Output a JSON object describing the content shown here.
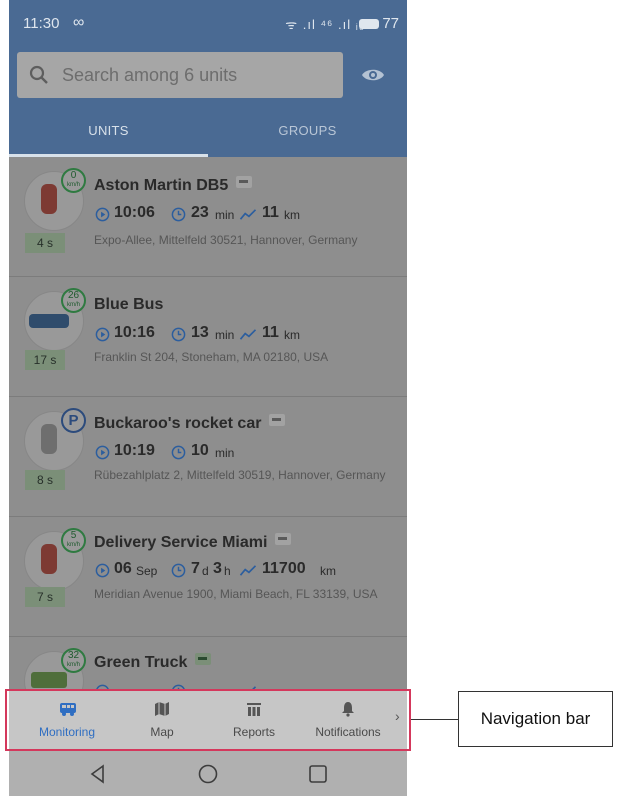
{
  "status_bar": {
    "time": "11:30",
    "loop_symbol": "∞",
    "signal_text": "ᯤ .ıl ⁴⁶ .ıl ᵢ₆",
    "battery": "77"
  },
  "search": {
    "placeholder": "Search among 6 units",
    "icon": "search-icon",
    "visibility_icon": "eye-icon"
  },
  "tabs": [
    {
      "label": "UNITS",
      "selected": true
    },
    {
      "label": "GROUPS",
      "selected": false
    }
  ],
  "units": [
    {
      "name": "Aston Martin DB5",
      "has_key": true,
      "key_color": "grey",
      "icon_type": "car-red",
      "badge": "speed",
      "speed": "0",
      "speed_unit": "km/h",
      "time": "10:06",
      "duration_value": "23",
      "duration_unit": "min",
      "distance_value": "11",
      "distance_unit": "km",
      "address": "Expo-Allee, Mittelfeld 30521, Hannover, Germany",
      "age": "4 s"
    },
    {
      "name": "Blue Bus",
      "has_key": false,
      "icon_type": "bus",
      "badge": "speed",
      "speed": "26",
      "speed_unit": "km/h",
      "time": "10:16",
      "duration_value": "13",
      "duration_unit": "min",
      "distance_value": "11",
      "distance_unit": "km",
      "address": "Franklin St 204, Stoneham, MA 02180, USA",
      "age": "17 s"
    },
    {
      "name": "Buckaroo's rocket car",
      "has_key": true,
      "key_color": "grey",
      "icon_type": "car-grey",
      "badge": "parking",
      "speed": "P",
      "time": "10:19",
      "duration_value": "10",
      "duration_unit": "min",
      "address": "Rübezahlplatz 2, Mittelfeld 30519, Hannover, Germany",
      "age": "8 s"
    },
    {
      "name": "Delivery Service Miami",
      "has_key": true,
      "key_color": "grey",
      "icon_type": "car-red",
      "badge": "speed",
      "speed": "5",
      "speed_unit": "km/h",
      "date_day": "06",
      "date_month": "Sep",
      "duration_d": "7",
      "duration_d_unit": "d",
      "duration_h": "3",
      "duration_h_unit": "h",
      "distance_value": "11700",
      "distance_unit": "km",
      "address": "Meridian Avenue 1900, Miami Beach, FL 33139, USA",
      "age": "7 s"
    },
    {
      "name": "Green Truck",
      "has_key": true,
      "key_color": "green",
      "icon_type": "truck",
      "badge": "speed",
      "speed": "32",
      "speed_unit": "km/h"
    }
  ],
  "nav": {
    "items": [
      {
        "label": "Monitoring",
        "icon": "bus-icon",
        "active": true
      },
      {
        "label": "Map",
        "icon": "map-icon",
        "active": false
      },
      {
        "label": "Reports",
        "icon": "reports-icon",
        "active": false
      },
      {
        "label": "Notifications",
        "icon": "bell-icon",
        "active": false
      }
    ],
    "more": "›"
  },
  "annotation": {
    "label": "Navigation bar",
    "color": "#d4385c"
  },
  "colors": {
    "accent_blue": "#2f6ec2",
    "header_blue_dimmed": "#4a6a93",
    "speed_badge_green": "#2f7a41"
  }
}
